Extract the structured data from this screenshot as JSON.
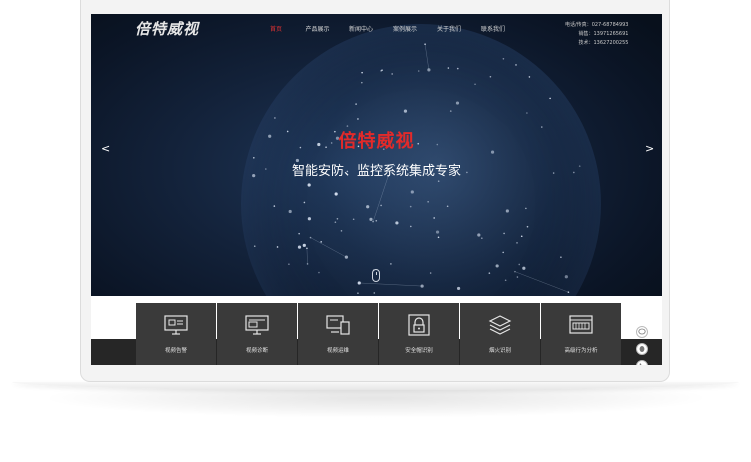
{
  "brand": {
    "logo_text": "倍特威视"
  },
  "nav": {
    "items": [
      {
        "label": "首页",
        "active": true
      },
      {
        "label": "产品展示",
        "active": false
      },
      {
        "label": "新闻中心",
        "active": false
      },
      {
        "label": "案例展示",
        "active": false
      },
      {
        "label": "关于我们",
        "active": false
      },
      {
        "label": "联系我们",
        "active": false
      }
    ]
  },
  "contacts": {
    "phone_fax_label": "电话/传真：",
    "phone_fax_value": "027-68784993",
    "sales_label": "销售：",
    "sales_value": "13971265691",
    "tech_label": "技术：",
    "tech_value": "13627200255"
  },
  "hero": {
    "title": "倍特威视",
    "subtitle": "智能安防、监控系统集成专家",
    "prev_arrow": "<",
    "next_arrow": ">"
  },
  "services": [
    {
      "label": "视频告警",
      "icon": "monitor-alert-icon"
    },
    {
      "label": "视频诊断",
      "icon": "monitor-diagnosis-icon"
    },
    {
      "label": "视频运维",
      "icon": "monitor-devices-icon"
    },
    {
      "label": "安全帽识别",
      "icon": "lock-icon"
    },
    {
      "label": "烟火识别",
      "icon": "layers-icon"
    },
    {
      "label": "高级行为分析",
      "icon": "behavior-analysis-icon"
    }
  ],
  "side_tools": [
    {
      "icon": "chat-icon"
    },
    {
      "icon": "qq-icon"
    },
    {
      "icon": "phone-icon"
    }
  ],
  "colors": {
    "accent_red": "#e22a2a",
    "hero_bg": "#13223a",
    "service_tile": "#3a3a3a"
  }
}
